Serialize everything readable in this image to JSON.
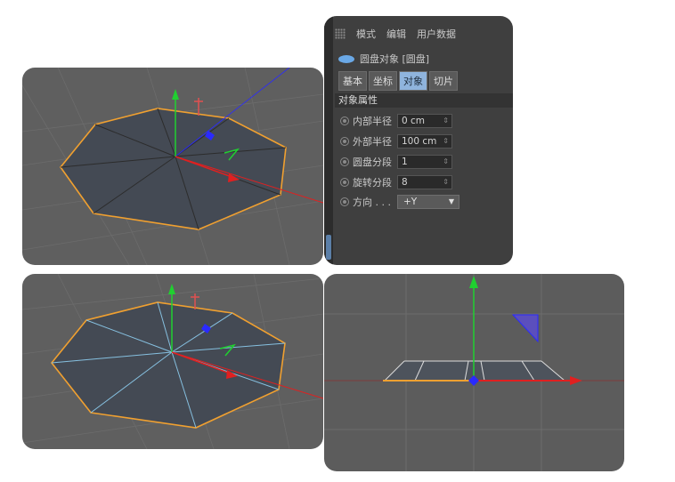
{
  "attributes_panel": {
    "menu": [
      "模式",
      "编辑",
      "用户数据"
    ],
    "object_title": "圆盘对象 [圆盘]",
    "tabs": [
      {
        "label": "基本",
        "active": false
      },
      {
        "label": "坐标",
        "active": false
      },
      {
        "label": "对象",
        "active": true
      },
      {
        "label": "切片",
        "active": false
      }
    ],
    "section_title": "对象属性",
    "params": {
      "inner_radius": {
        "label": "内部半径",
        "value": "0 cm"
      },
      "outer_radius": {
        "label": "外部半径",
        "value": "100 cm"
      },
      "disc_segments": {
        "label": "圆盘分段",
        "value": "1"
      },
      "rotation_segments": {
        "label": "旋转分段",
        "value": "8"
      },
      "orientation": {
        "label": "方向 . . .",
        "value": "+Y"
      }
    }
  },
  "colors": {
    "viewport_bg": "#5f5f5f",
    "disc_fill": "#444a54",
    "selection_edge": "#f0a030",
    "wire_dark": "#303030",
    "wire_light": "#86c0e0",
    "axis_x": "#e02020",
    "axis_y": "#20d030",
    "axis_z": "#2a2aff"
  },
  "icons": {
    "grip": "panel-grip-icon",
    "object": "disc-object-icon",
    "spinner": "spinner-arrows-icon",
    "dropdown": "chevron-down-icon"
  }
}
